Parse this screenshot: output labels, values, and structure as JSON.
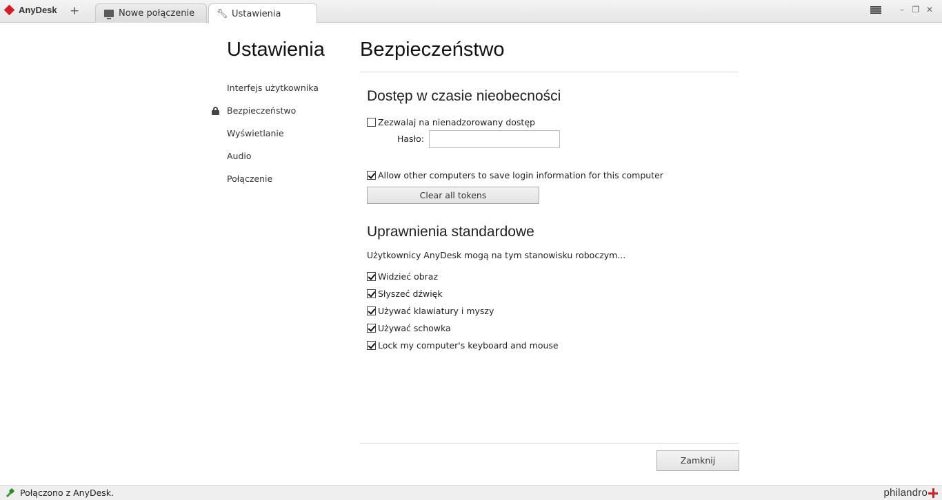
{
  "app": {
    "brand": "AnyDesk",
    "new_tab_symbol": "+",
    "tabs": [
      {
        "label": "Nowe połączenie",
        "icon": "monitor-icon",
        "active": false
      },
      {
        "label": "Ustawienia",
        "icon": "wrench-icon",
        "active": true
      }
    ],
    "window_controls": {
      "minimize": "–",
      "restore": "❐",
      "close": "✕"
    }
  },
  "settings": {
    "title": "Ustawienia",
    "nav": [
      {
        "label": "Interfejs użytkownika",
        "selected": false
      },
      {
        "label": "Bezpieczeństwo",
        "selected": true,
        "icon": "lock-icon"
      },
      {
        "label": "Wyświetlanie",
        "selected": false
      },
      {
        "label": "Audio",
        "selected": false
      },
      {
        "label": "Połączenie",
        "selected": false
      }
    ]
  },
  "main": {
    "title": "Bezpieczeństwo",
    "unattended": {
      "heading": "Dostęp w czasie nieobecności",
      "allow_label": "Zezwalaj na nienadzorowany dostęp",
      "allow_checked": false,
      "password_label": "Hasło:",
      "password_value": "",
      "save_login_label": "Allow other computers to save login information for this computer",
      "save_login_checked": true,
      "clear_tokens_label": "Clear all tokens"
    },
    "permissions": {
      "heading": "Uprawnienia standardowe",
      "description": "Użytkownicy AnyDesk mogą na tym stanowisku roboczym...",
      "items": [
        {
          "label": "Widzieć obraz",
          "checked": true
        },
        {
          "label": "Słyszeć dźwięk",
          "checked": true
        },
        {
          "label": "Używać klawiatury i myszy",
          "checked": true
        },
        {
          "label": "Używać schowka",
          "checked": true
        },
        {
          "label": "Lock my computer's keyboard and mouse",
          "checked": true
        }
      ]
    },
    "close_label": "Zamknij"
  },
  "status": {
    "text": "Połączono z AnyDesk.",
    "vendor": "philandro"
  },
  "colors": {
    "brand_red": "#d21f26",
    "status_green": "#3c9a3c"
  }
}
